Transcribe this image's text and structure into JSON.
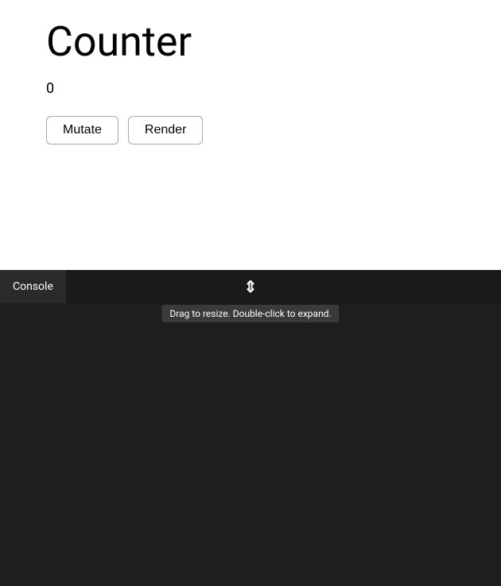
{
  "app": {
    "title": "Counter",
    "counter_value": "0"
  },
  "buttons": {
    "mutate_label": "Mutate",
    "render_label": "Render"
  },
  "console": {
    "tab_label": "Console",
    "tooltip_text": "Drag to resize. Double-click to expand."
  },
  "colors": {
    "background": "#ffffff",
    "console_bg": "#1e1e1e",
    "bar_bg": "#1a1a1a",
    "tab_bg": "#2a2a2a",
    "text_white": "#ffffff",
    "text_black": "#000000"
  }
}
